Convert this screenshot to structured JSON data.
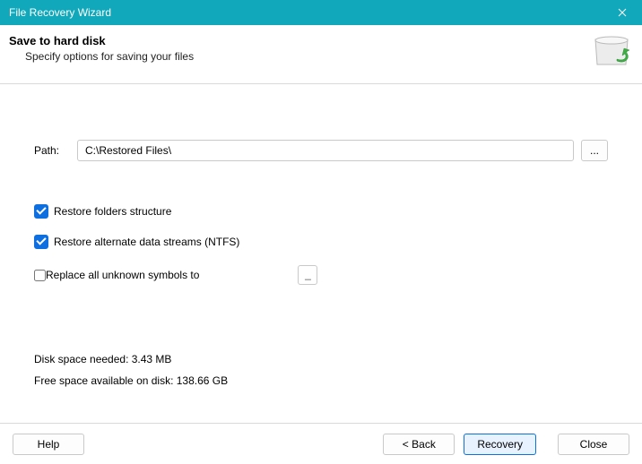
{
  "window": {
    "title": "File Recovery Wizard"
  },
  "header": {
    "title": "Save to hard disk",
    "subtitle": "Specify options for saving your files"
  },
  "path": {
    "label": "Path:",
    "value": "C:\\Restored Files\\",
    "browse": "..."
  },
  "options": {
    "restore_folders": {
      "label": "Restore folders structure",
      "checked": true
    },
    "restore_alt_streams": {
      "label": "Restore alternate data streams (NTFS)",
      "checked": true
    },
    "replace_unknown": {
      "label": "Replace all unknown symbols to",
      "checked": false,
      "value": "_"
    }
  },
  "info": {
    "space_needed": "Disk space needed: 3.43 MB",
    "free_space": "Free space available on disk: 138.66 GB"
  },
  "footer": {
    "help": "Help",
    "back": "< Back",
    "recovery": "Recovery",
    "close": "Close"
  }
}
